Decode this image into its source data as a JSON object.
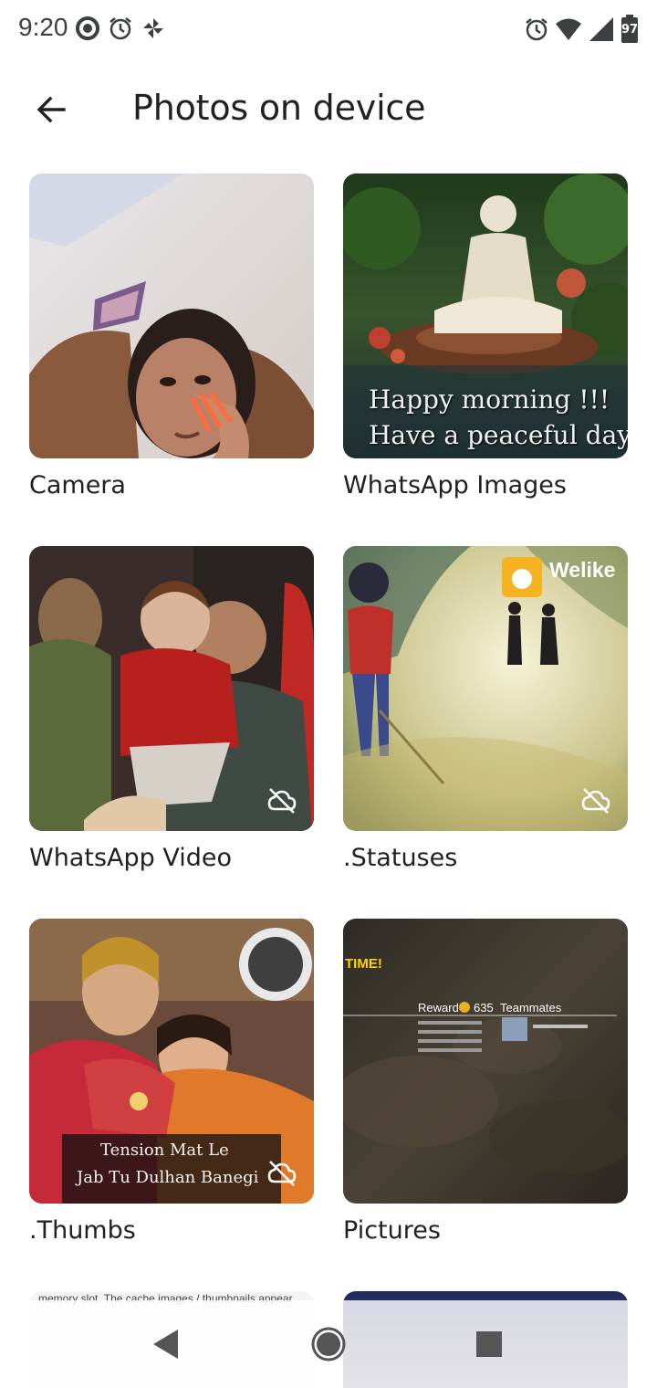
{
  "status_bar": {
    "time": "9:20",
    "battery_level": "97",
    "icons_left": [
      "data-saver-icon",
      "alarm-icon",
      "pinwheel-icon"
    ],
    "icons_right": [
      "alarm-icon",
      "wifi-icon",
      "signal-icon",
      "battery-icon"
    ]
  },
  "app_bar": {
    "back_icon": "arrow-back-icon",
    "title": "Photos on device"
  },
  "folders": [
    {
      "label": "Camera",
      "backed_up": true
    },
    {
      "label": "WhatsApp Images",
      "backed_up": true,
      "overlay_text": [
        "Happy morning !!!",
        "Have a peaceful day"
      ]
    },
    {
      "label": "WhatsApp Video",
      "backed_up": false
    },
    {
      "label": ".Statuses",
      "backed_up": false,
      "overlay_text": [
        "Welike"
      ]
    },
    {
      "label": ".Thumbs",
      "backed_up": false,
      "overlay_text": [
        "Tension Mat Le",
        "Jab Tu Dulhan Banegi"
      ]
    },
    {
      "label": "Pictures",
      "backed_up": true,
      "overlay_text": [
        "TIME!",
        "Reward",
        "635",
        "Teammates"
      ]
    }
  ],
  "partial_row_text": "memory slot. The cache images / thumbnails appear",
  "nav_bar": {
    "buttons": [
      "back-triangle-icon",
      "home-circle-icon",
      "recents-square-icon"
    ]
  },
  "colors": {
    "text_primary": "#202124",
    "icon_gray": "#5f6368"
  }
}
